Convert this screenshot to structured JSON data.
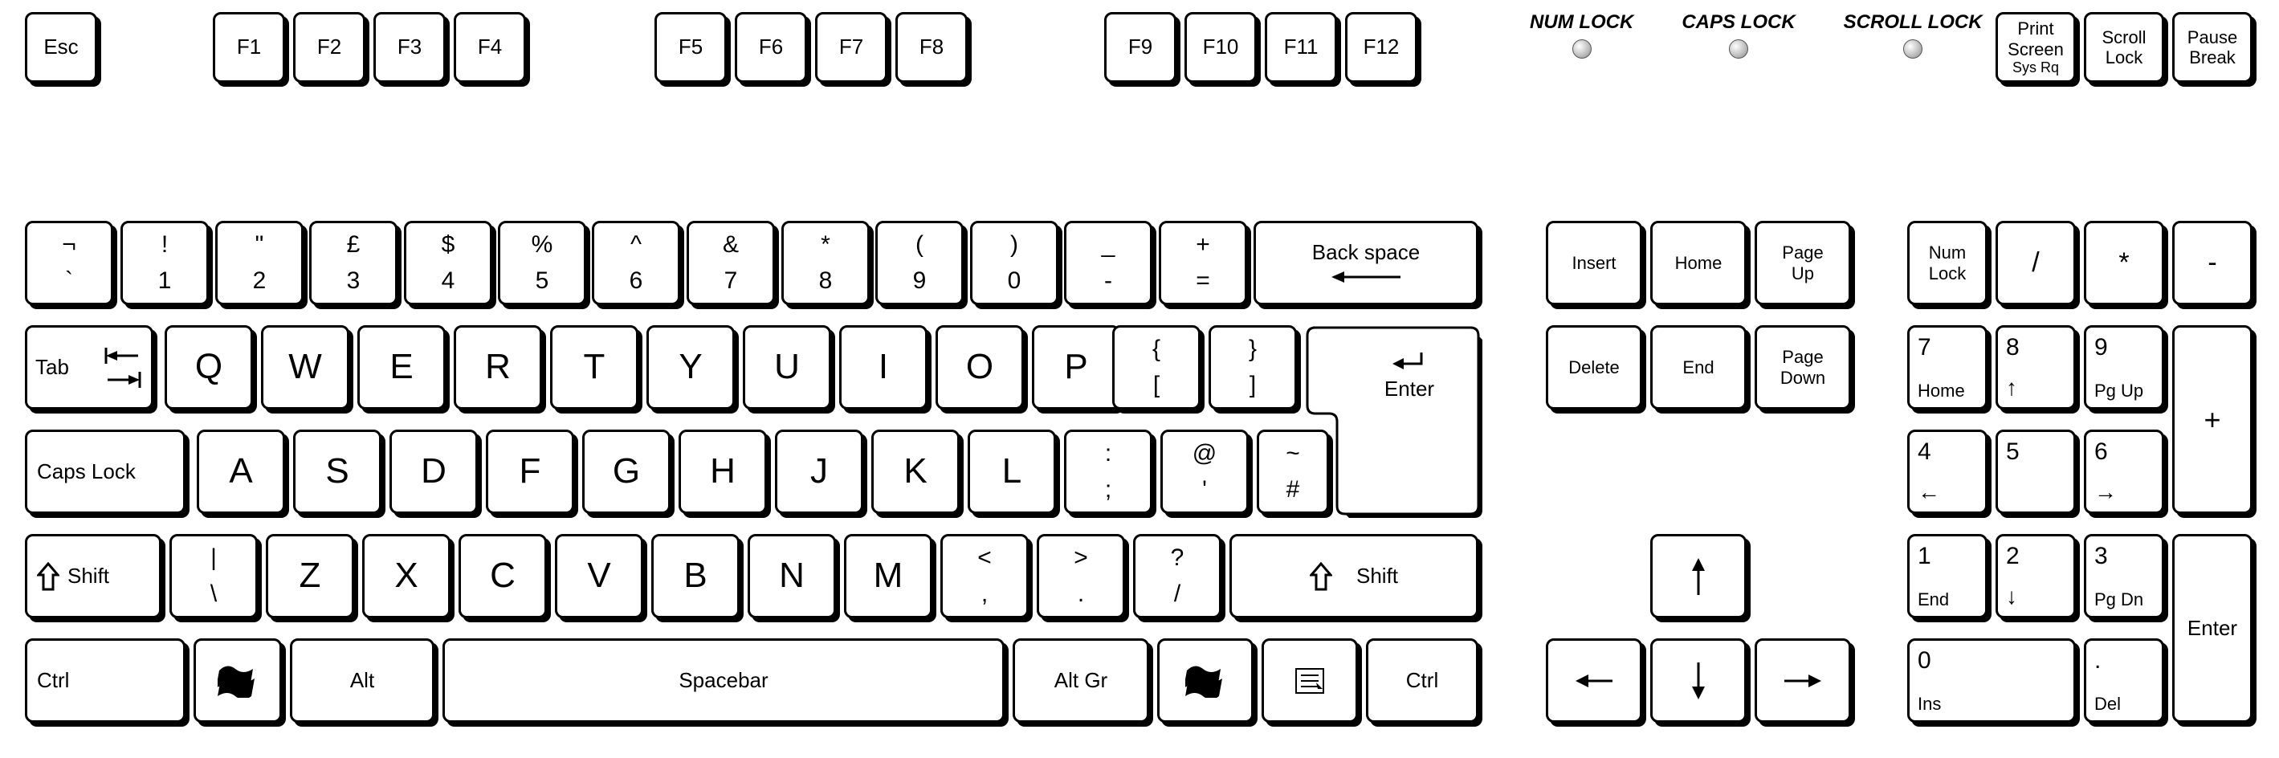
{
  "esc": "Esc",
  "f": [
    "F1",
    "F2",
    "F3",
    "F4",
    "F5",
    "F6",
    "F7",
    "F8",
    "F9",
    "F10",
    "F11",
    "F12"
  ],
  "leds": {
    "num": "NUM\nLOCK",
    "caps": "CAPS\nLOCK",
    "scroll": "SCROLL\nLOCK"
  },
  "sys": {
    "print": "Print\nScreen",
    "sysrq": "Sys Rq",
    "scroll": "Scroll\nLock",
    "pause": "Pause\nBreak"
  },
  "row1": [
    {
      "t": "¬",
      "b": "`"
    },
    {
      "t": "!",
      "b": "1"
    },
    {
      "t": "\"",
      "b": "2"
    },
    {
      "t": "£",
      "b": "3"
    },
    {
      "t": "$",
      "b": "4"
    },
    {
      "t": "%",
      "b": "5"
    },
    {
      "t": "^",
      "b": "6"
    },
    {
      "t": "&",
      "b": "7"
    },
    {
      "t": "*",
      "b": "8"
    },
    {
      "t": "(",
      "b": "9"
    },
    {
      "t": ")",
      "b": "0"
    },
    {
      "t": "_",
      "b": "-"
    },
    {
      "t": "+",
      "b": "="
    }
  ],
  "backspace": "Back space",
  "tab": "Tab",
  "row2": [
    "Q",
    "W",
    "E",
    "R",
    "T",
    "Y",
    "U",
    "I",
    "O",
    "P"
  ],
  "brackets": [
    {
      "t": "{",
      "b": "["
    },
    {
      "t": "}",
      "b": "]"
    }
  ],
  "enter": "Enter",
  "caps": "Caps Lock",
  "row3": [
    "A",
    "S",
    "D",
    "F",
    "G",
    "H",
    "J",
    "K",
    "L"
  ],
  "semi": {
    "t": ":",
    "b": ";"
  },
  "at": {
    "t": "@",
    "b": "'"
  },
  "hash": {
    "t": "~",
    "b": "#"
  },
  "shift": "Shift",
  "backslash": {
    "t": "|",
    "b": "\\"
  },
  "row4": [
    "Z",
    "X",
    "C",
    "V",
    "B",
    "N",
    "M"
  ],
  "comma": {
    "t": "<",
    "b": ","
  },
  "period": {
    "t": ">",
    "b": "."
  },
  "slash": {
    "t": "?",
    "b": "/"
  },
  "ctrl": "Ctrl",
  "alt": "Alt",
  "space": "Spacebar",
  "altgr": "Alt Gr",
  "nav": {
    "insert": "Insert",
    "home": "Home",
    "pgup": "Page\nUp",
    "delete": "Delete",
    "end": "End",
    "pgdn": "Page\nDown"
  },
  "np": {
    "numlock": "Num\nLock",
    "div": "/",
    "mul": "*",
    "sub": "-",
    "add": "+",
    "ent": "Enter",
    "7": {
      "t": "7",
      "b": "Home"
    },
    "8": {
      "t": "8",
      "b": "↑"
    },
    "9": {
      "t": "9",
      "b": "Pg Up"
    },
    "4": {
      "t": "4",
      "b": "←"
    },
    "5": {
      "t": "5",
      "b": ""
    },
    "6": {
      "t": "6",
      "b": "→"
    },
    "1": {
      "t": "1",
      "b": "End"
    },
    "2": {
      "t": "2",
      "b": "↓"
    },
    "3": {
      "t": "3",
      "b": "Pg Dn"
    },
    "0": {
      "t": "0",
      "b": "Ins"
    },
    "dot": {
      "t": ".",
      "b": "Del"
    }
  }
}
